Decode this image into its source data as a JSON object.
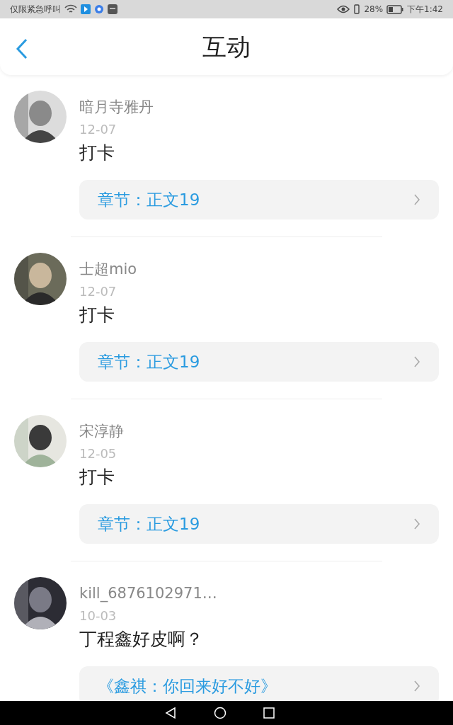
{
  "status_bar": {
    "carrier": "仅限紧急呼叫",
    "battery": "28%",
    "time": "下午1:42"
  },
  "header": {
    "title": "互动"
  },
  "items": [
    {
      "name": "暗月寺雅丹",
      "date": "12-07",
      "comment": "打卡",
      "chapter": "章节：正文19"
    },
    {
      "name": "士超mio",
      "date": "12-07",
      "comment": "打卡",
      "chapter": "章节：正文19"
    },
    {
      "name": "宋淳静",
      "date": "12-05",
      "comment": "打卡",
      "chapter": "章节：正文19"
    },
    {
      "name": "kill_6876102971…",
      "date": "10-03",
      "comment": "丁程鑫好皮啊？",
      "chapter": "《鑫祺：你回来好不好》"
    }
  ]
}
